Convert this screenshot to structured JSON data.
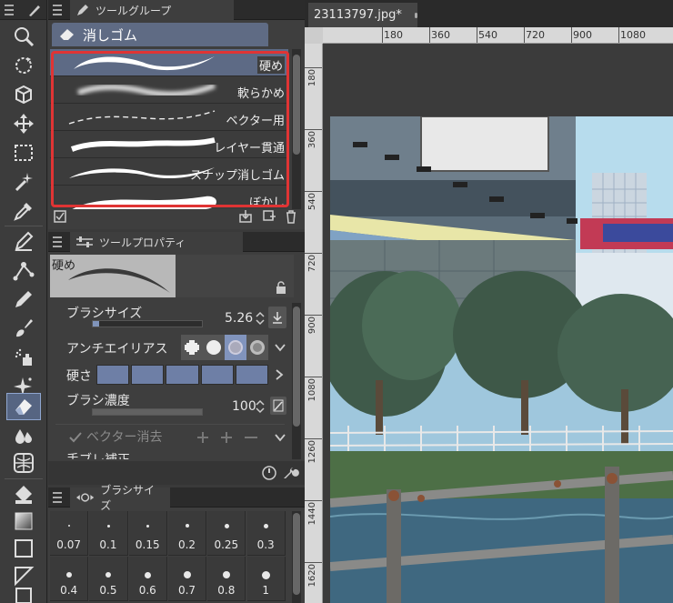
{
  "tool_group_panel": {
    "tab_label": "ツールグループ",
    "group_name": "消しゴム",
    "subtools": [
      {
        "label": "硬め",
        "selected": true
      },
      {
        "label": "軟らかめ",
        "selected": false
      },
      {
        "label": "ベクター用",
        "selected": false
      },
      {
        "label": "レイヤー貫通",
        "selected": false
      },
      {
        "label": "スナップ消しゴム",
        "selected": false
      },
      {
        "label": "ぼかし",
        "selected": false
      }
    ]
  },
  "tool_property_panel": {
    "tab_label": "ツールプロパティ",
    "preview_label": "硬め",
    "brush_size_label": "ブラシサイズ",
    "brush_size_value": "5.26",
    "brush_size_fill": 0.06,
    "antialias_label": "アンチエイリアス",
    "hardness_label": "硬さ",
    "hardness_level": 5,
    "density_label": "ブラシ濃度",
    "density_value": "100",
    "density_fill": 1.0,
    "vector_erase_label": "ベクター消去",
    "stabilization_label": "手ブレ補正"
  },
  "brush_size_panel": {
    "tab_label": "ブラシサイズ",
    "sizes": [
      "0.07",
      "0.1",
      "0.15",
      "0.2",
      "0.25",
      "0.3",
      "0.4",
      "0.5",
      "0.6",
      "0.7",
      "0.8",
      "1"
    ]
  },
  "canvas": {
    "tab_title": "23113797.jpg*",
    "ruler_h": [
      "180",
      "360",
      "540",
      "720",
      "900",
      "1080"
    ],
    "ruler_v": [
      "180",
      "360",
      "540",
      "720",
      "900",
      "1080",
      "1260",
      "1440",
      "1620"
    ]
  },
  "colors": {
    "accent": "#5d6a85",
    "highlight": "#e03434",
    "panel_bg": "#3e3e3e"
  }
}
